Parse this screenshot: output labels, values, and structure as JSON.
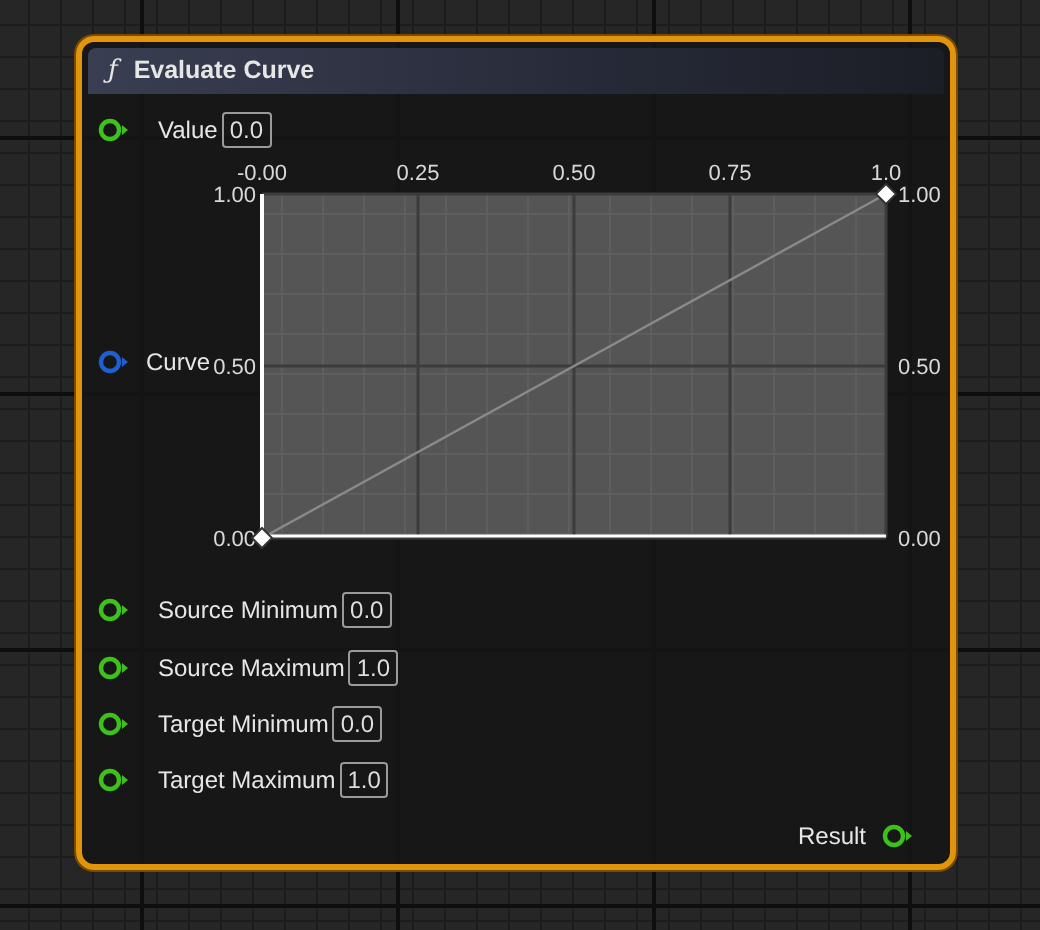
{
  "node": {
    "title_icon": "ƒ",
    "title": "Evaluate Curve",
    "selected": true
  },
  "inputs_top": [
    {
      "label": "Value",
      "value": "0.0",
      "color": "#3cc21a"
    }
  ],
  "curve_pin": {
    "label": "Curve",
    "color": "#1f5fd0"
  },
  "curve": {
    "right_labels": [
      "1.00",
      "0.50",
      "0.00"
    ],
    "chart_data": {
      "type": "line",
      "x": [
        0,
        1
      ],
      "series": [
        {
          "color": "#8a8a8a",
          "marker": "diamond",
          "values": [
            0,
            1
          ]
        }
      ],
      "grid": true,
      "xlim": [
        0,
        1
      ],
      "ylim": [
        0,
        1
      ],
      "xticks": [
        {
          "value": 0,
          "label": "-0.00"
        },
        {
          "value": 0.25,
          "label": "0.25"
        },
        {
          "value": 0.5,
          "label": "0.50"
        },
        {
          "value": 0.75,
          "label": "0.75"
        },
        {
          "value": 1,
          "label": "1.0"
        }
      ],
      "yticks": [
        {
          "value": 1,
          "label": "1.00"
        },
        {
          "value": 0.5,
          "label": "0.50"
        },
        {
          "value": 0,
          "label": "0.00"
        }
      ]
    }
  },
  "inputs": [
    {
      "label": "Source Minimum",
      "value": "0.0",
      "color": "#3cc21a"
    },
    {
      "label": "Source Maximum",
      "value": "1.0",
      "color": "#3cc21a"
    },
    {
      "label": "Target Minimum",
      "value": "0.0",
      "color": "#3cc21a"
    },
    {
      "label": "Target Maximum",
      "value": "1.0",
      "color": "#3cc21a"
    }
  ],
  "output": {
    "label": "Result",
    "color": "#3cc21a"
  }
}
